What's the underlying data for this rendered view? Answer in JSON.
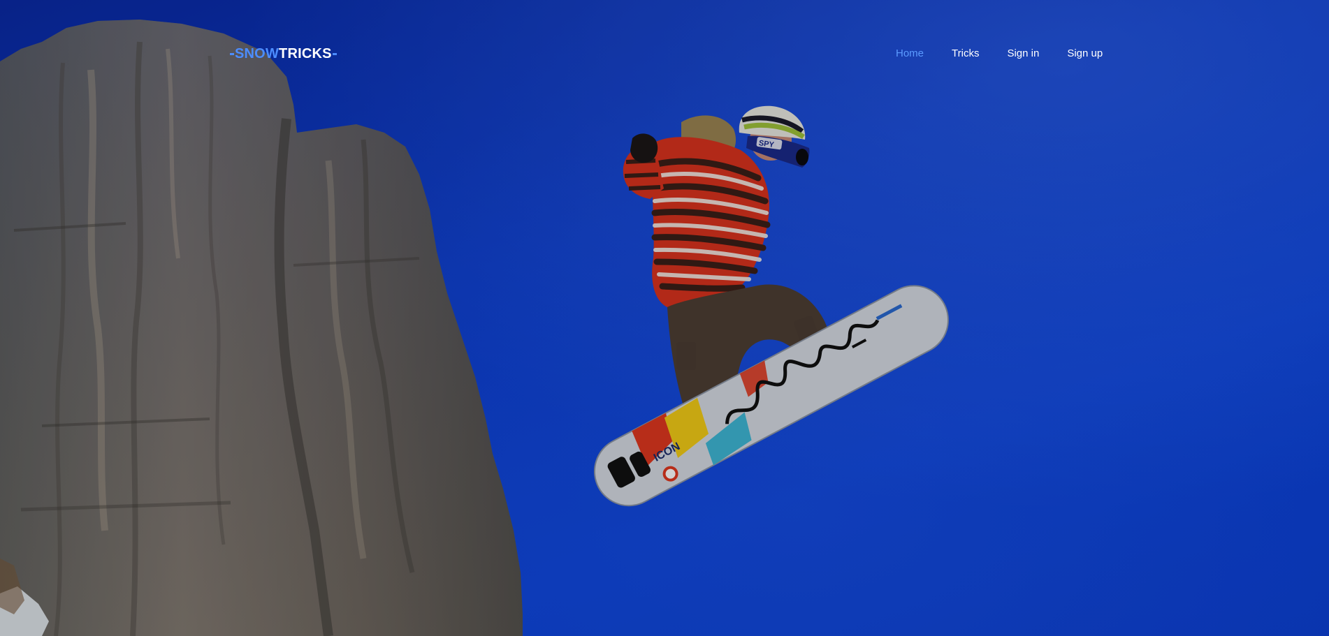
{
  "brand": {
    "logo_part1": "SNOW",
    "logo_part2": "TRICKS",
    "accent_color": "#4c8dff"
  },
  "nav": {
    "items": [
      {
        "label": "Home",
        "active": true
      },
      {
        "label": "Tricks",
        "active": false
      },
      {
        "label": "Sign in",
        "active": false
      },
      {
        "label": "Sign up",
        "active": false
      }
    ]
  },
  "hero": {
    "board_label": "ICON",
    "helmet_label": "SPY"
  }
}
